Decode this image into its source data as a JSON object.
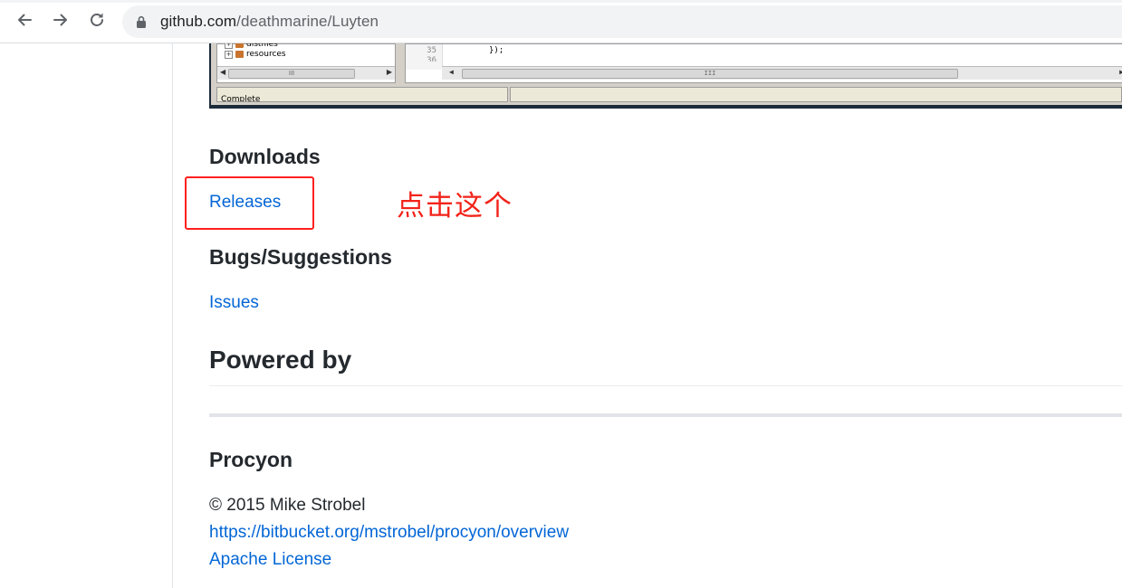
{
  "browser": {
    "url_host": "github.com",
    "url_path": "/deathmarine/Luyten",
    "back_icon": "arrow-left-icon",
    "forward_icon": "arrow-right-icon",
    "reload_icon": "reload-icon",
    "lock_icon": "lock-icon"
  },
  "embedded_screenshot": {
    "tree_items": [
      "distfiles",
      "resources"
    ],
    "line_numbers": [
      "35",
      "36"
    ],
    "code_line": "});",
    "status_text": "Complete"
  },
  "sections": {
    "downloads_heading": "Downloads",
    "releases_link": "Releases",
    "bugs_heading": "Bugs/Suggestions",
    "issues_link": "Issues",
    "powered_by_heading": "Powered by",
    "procyon_heading": "Procyon",
    "copyright": "© 2015 Mike Strobel",
    "procyon_url": "https://bitbucket.org/mstrobel/procyon/overview",
    "license_link": "Apache License"
  },
  "annotation": {
    "text": "点击这个",
    "color": "#f2231a"
  }
}
